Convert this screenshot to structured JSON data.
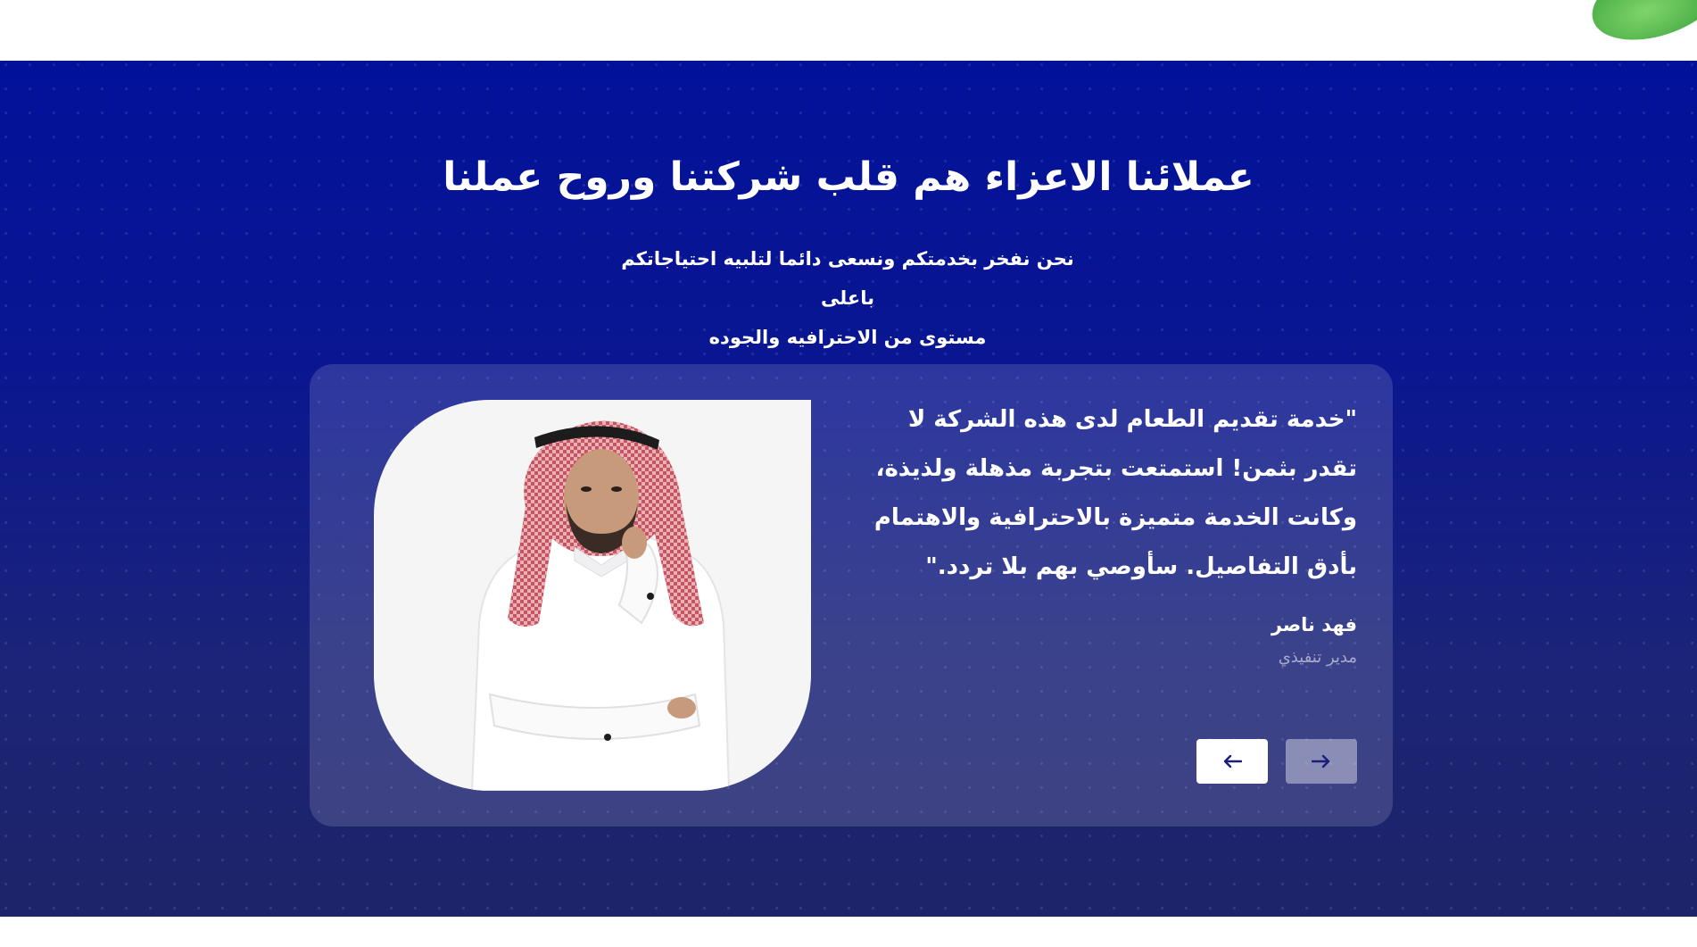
{
  "section": {
    "title": "عملائنا الاعزاء هم قلب شركتنا وروح عملنا",
    "subtitle_line1": "نحن نفخر بخدمتكم ونسعى دائما لتلبيه احتياجاتكم باعلى",
    "subtitle_line2": "مستوى من الاحترافيه والجوده"
  },
  "testimonial": {
    "quote": "\"خدمة تقديم الطعام لدى هذه الشركة لا تقدر بثمن! استمتعت بتجربة مذهلة ولذيذة، وكانت الخدمة متميزة بالاحترافية والاهتمام بأدق التفاصيل. سأوصي بهم بلا تردد.\"",
    "author_name": "فهد ناصر",
    "author_role": "مدير تنفيذي"
  },
  "nav": {
    "prev_icon": "arrow-left-icon",
    "next_icon": "arrow-right-icon"
  },
  "colors": {
    "section_top": "#02119a",
    "section_bottom": "#1e2468",
    "button_icon": "#1a1f7a"
  }
}
